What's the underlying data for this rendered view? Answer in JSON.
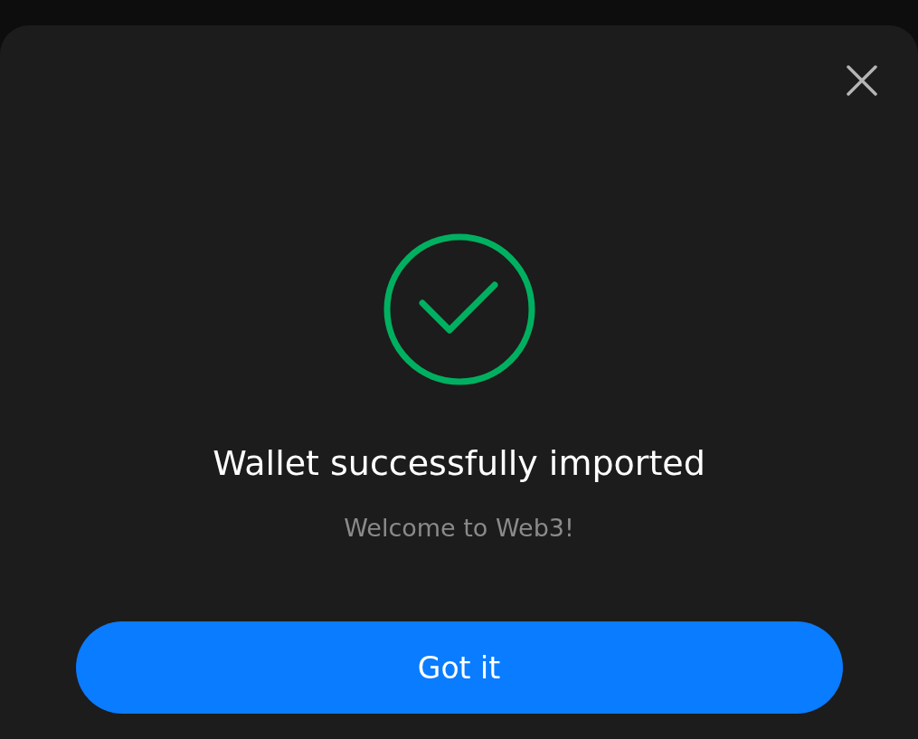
{
  "dialog": {
    "title": "Wallet successfully imported",
    "subtitle": "Welcome to Web3!",
    "button": "Got it"
  }
}
